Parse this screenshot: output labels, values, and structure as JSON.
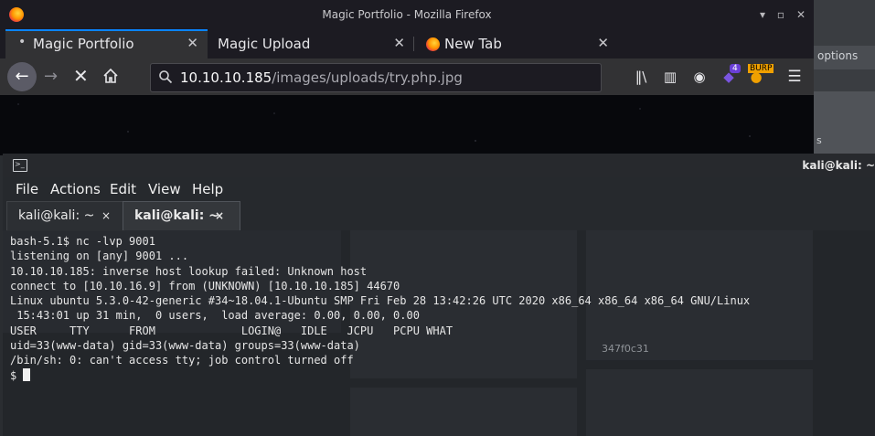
{
  "background_window": {
    "options_label": "options",
    "s_label": "s"
  },
  "firefox": {
    "window_title": "Magic Portfolio - Mozilla Firefox",
    "window_controls": {
      "minimize": "▾",
      "restore": "▫",
      "close": "✕"
    },
    "tabs": [
      {
        "label": "Magic Portfolio",
        "close": "✕",
        "loading_indicator": "•"
      },
      {
        "label": "Magic Upload",
        "close": "✕"
      },
      {
        "label": "New Tab",
        "close": "✕"
      }
    ],
    "new_tab_symbol": "+",
    "url": {
      "host": "10.10.10.185",
      "path": "/images/uploads/try.php.jpg"
    },
    "extensions": {
      "badge_count": "4",
      "burp_label": "BURP"
    },
    "icons": [
      "back-icon",
      "forward-icon",
      "stop-icon",
      "home-icon",
      "search-icon",
      "library-icon",
      "sidebar-icon",
      "account-icon",
      "extension-icon",
      "burp-icon",
      "menu-icon"
    ]
  },
  "terminal": {
    "title": "kali@kali: ~",
    "menu": [
      "File",
      "Actions",
      "Edit",
      "View",
      "Help"
    ],
    "tabs": [
      {
        "label": "kali@kali: ~",
        "close": "×",
        "active": false
      },
      {
        "label": "kali@kali: ~",
        "close": "×",
        "active": true
      }
    ],
    "lines": [
      "bash-5.1$ nc -lvp 9001",
      "listening on [any] 9001 ...",
      "10.10.10.185: inverse host lookup failed: Unknown host",
      "connect to [10.10.16.9] from (UNKNOWN) [10.10.10.185] 44670",
      "Linux ubuntu 5.3.0-42-generic #34~18.04.1-Ubuntu SMP Fri Feb 28 13:42:26 UTC 2020 x86_64 x86_64 x86_64 GNU/Linux",
      " 15:43:01 up 31 min,  0 users,  load average: 0.00, 0.00, 0.00",
      "USER     TTY      FROM             LOGIN@   IDLE   JCPU   PCPU WHAT",
      "uid=33(www-data) gid=33(www-data) groups=33(www-data)",
      "/bin/sh: 0: can't access tty; job control turned off"
    ],
    "prompt": "$ ",
    "background_tile_text": "347f0c31"
  }
}
